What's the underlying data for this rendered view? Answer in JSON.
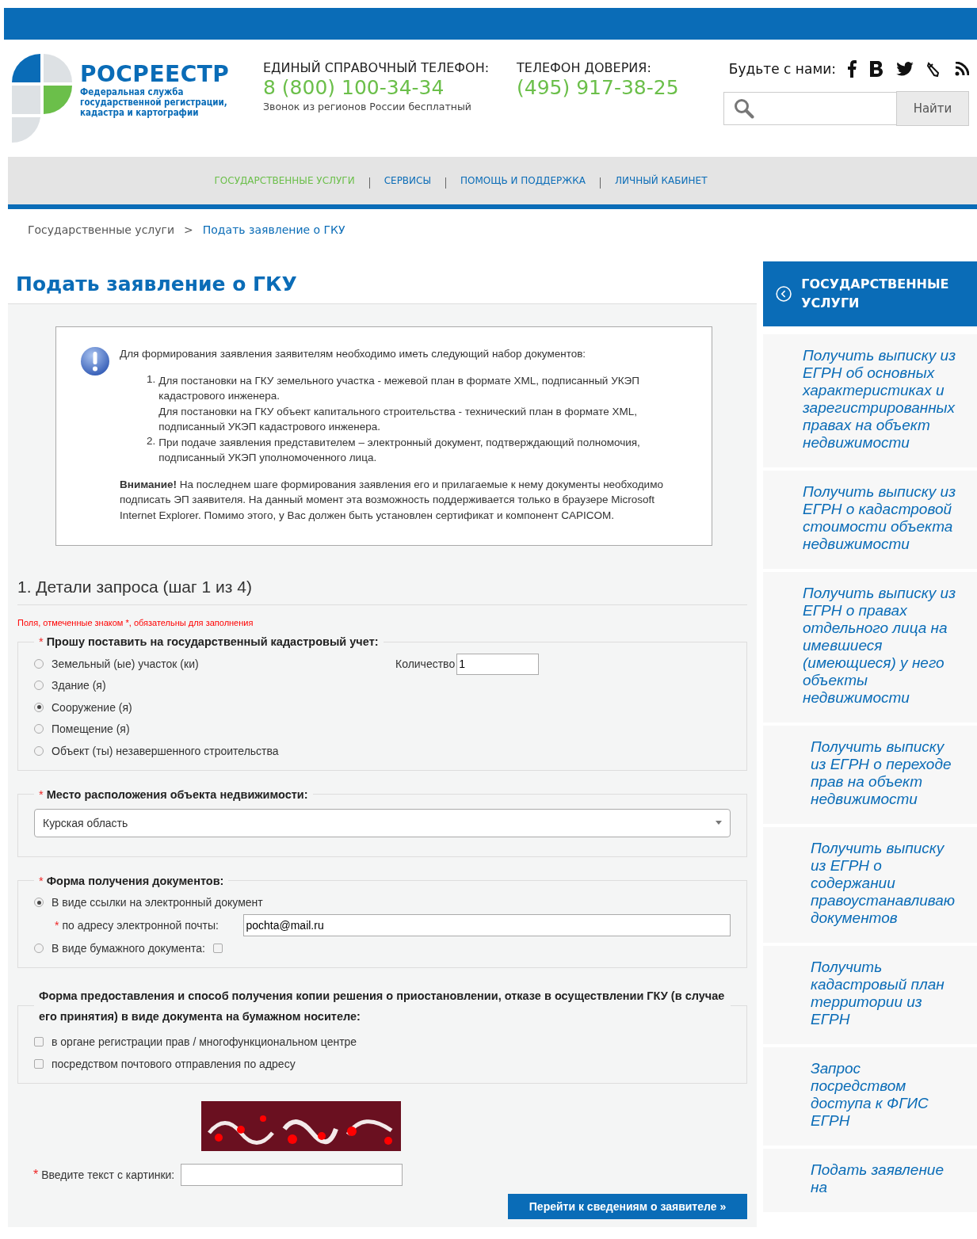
{
  "header": {
    "logo": {
      "title": "РОСРЕЕСТР",
      "subtitle": "Федеральная служба государственной регистрации, кадастра и картографии"
    },
    "phones": [
      {
        "label": "ЕДИНЫЙ СПРАВОЧНЫЙ ТЕЛЕФОН:",
        "number": "8 (800) 100-34-34",
        "note": "Звонок из регионов России бесплатный"
      },
      {
        "label": "ТЕЛЕФОН ДОВЕРИЯ:",
        "number": "(495) 917-38-25"
      }
    ],
    "social": {
      "label": "Будьте с нами:",
      "icons": [
        {
          "kind": "facebook"
        },
        {
          "kind": "vk"
        },
        {
          "kind": "twitter"
        },
        {
          "kind": "pencil"
        },
        {
          "kind": "rss"
        }
      ]
    },
    "search": {
      "button": "Найти"
    }
  },
  "nav": [
    {
      "label": "ГОСУДАРСТВЕННЫЕ УСЛУГИ",
      "selected": true
    },
    {
      "label": "СЕРВИСЫ",
      "selected": false
    },
    {
      "label": "ПОМОЩЬ И ПОДДЕРЖКА",
      "selected": false
    },
    {
      "label": "ЛИЧНЫЙ КАБИНЕТ",
      "selected": false
    }
  ],
  "breadcrumb": {
    "separator": ">",
    "items": [
      "Государственные услуги",
      "Подать заявление о ГКУ"
    ]
  },
  "page_title": "Подать заявление о ГКУ",
  "notice": {
    "intro": "Для формирования заявления заявителям необходимо иметь следующий набор документов:",
    "items": [
      {
        "number": "1.",
        "paragraphs": [
          "Для постановки на ГКУ земельного участка - межевой план в формате XML, подписанный УКЭП кадастрового инженера.",
          "Для постановки на ГКУ объект капитального строительства - технический план в формате XML, подписанный УКЭП кадастрового инженера."
        ]
      },
      {
        "number": "2.",
        "paragraphs": [
          "При подаче заявления представителем – электронный документ, подтверждающий полномочия, подписанный УКЭП уполномоченного лица."
        ]
      }
    ],
    "warning": "**Внимание!** На последнем шаге формирования заявления его и прилагаемые к нему документы необходимо подписать ЭП заявителя. На данный момент эта возможность поддерживается только в браузере Microsoft Internet Explorer. Помимо этого, у Вас должен быть установлен сертификат и компонент CAPICOM."
  },
  "step_title": "1. Детали запроса (шаг 1 из 4)",
  "required_note": "Поля, отмеченные знаком *, обязательны для заполнения",
  "object_type": {
    "mark": "*",
    "legend": "Прошу поставить на государственный кадастровый учет:",
    "options": [
      {
        "label": "Земельный (ые) участок (ки)",
        "selected": false
      },
      {
        "label": "Здание (я)",
        "selected": false
      },
      {
        "label": "Сооружение (я)",
        "selected": true
      },
      {
        "label": "Помещение (я)",
        "selected": false
      },
      {
        "label": "Объект (ты) незавершенного строительства",
        "selected": false
      }
    ],
    "quantity": {
      "label": "Количество",
      "value": "1"
    }
  },
  "location": {
    "mark": "*",
    "legend": "Место расположения объекта недвижимости:",
    "value": "Курская область"
  },
  "delivery": {
    "mark": "*",
    "legend": "Форма получения документов:",
    "electronic": {
      "label": "В виде ссылки на электронный документ",
      "selected": true
    },
    "email": {
      "mark": "*",
      "label": "по адресу электронной почты:",
      "value": "pochta@mail.ru"
    },
    "paper": {
      "label": "В виде бумажного документа:",
      "selected": false,
      "checked": false
    }
  },
  "copy_form": {
    "legend": "Форма предоставления и способ получения копии решения о приостановлении, отказе в осуществлении ГКУ (в случае его принятия) в виде документа на бумажном носителе:",
    "options": [
      {
        "label": "в органе регистрации прав / многофункциональном центре",
        "checked": false
      },
      {
        "label": "посредством почтового отправления по адресу",
        "checked": false
      }
    ]
  },
  "captcha": {
    "mark": "*",
    "label": "Введите текст с картинки:"
  },
  "submit": "Перейти к сведениям о заявителе »",
  "sidebar": {
    "title": "ГОСУДАРСТВЕННЫЕ УСЛУГИ",
    "items": [
      "Получить выписку из ЕГРН об основных характеристиках и зарегистрированных правах на объект недвижимости",
      "Получить выписку из ЕГРН о кадастровой стоимости объекта недвижимости",
      "Получить выписку из ЕГРН о правах отдельного лица на имевшиеся (имеющиеся) у него объекты недвижимости",
      "Получить выписку из ЕГРН о переходе прав на объект недвижимости",
      "Получить выписку из ЕГРН о содержании правоустанавливаю документов",
      "Получить кадастровый план территории из ЕГРН",
      "Запрос посредством доступа к ФГИС ЕГРН",
      "Подать заявление на"
    ]
  }
}
